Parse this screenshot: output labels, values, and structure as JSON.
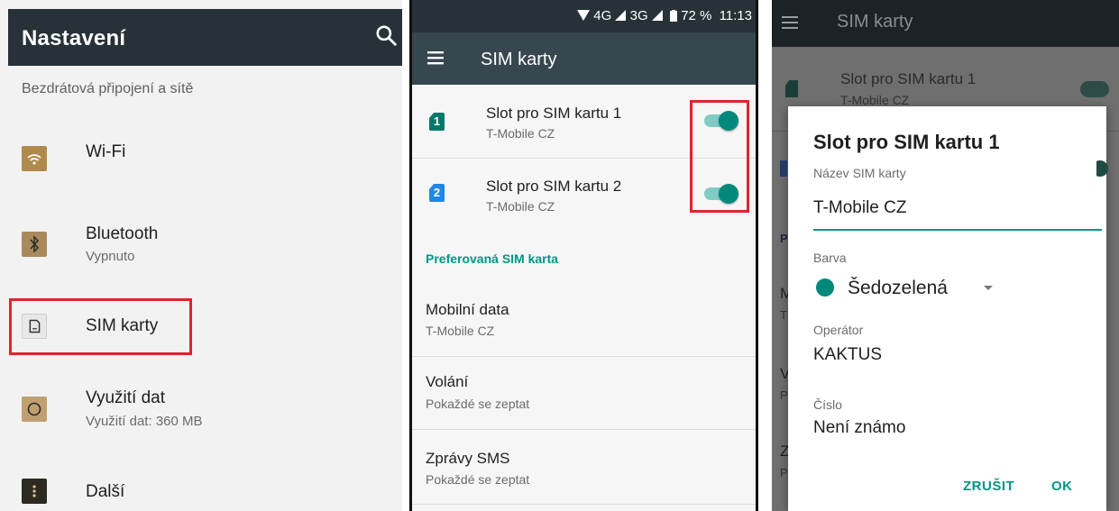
{
  "panel1": {
    "title": "Nastavení",
    "icons": {
      "search": "search-icon"
    },
    "section_header": "Bezdrátová připojení a sítě",
    "items": [
      {
        "label": "Wi-Fi",
        "sub": "",
        "icon": "wifi-icon",
        "color": "#b08a4a"
      },
      {
        "label": "Bluetooth",
        "sub": "Vypnuto",
        "icon": "bluetooth-icon",
        "color": "#a88a5c"
      },
      {
        "label": "SIM karty",
        "sub": "",
        "icon": "sim-card-icon",
        "color": "#e8e8e8"
      },
      {
        "label": "Využití dat",
        "sub": "Využití dat: 360 MB",
        "icon": "data-usage-icon",
        "color": "#c0a070"
      },
      {
        "label": "Další",
        "sub": "",
        "icon": "more-icon",
        "color": "#2d2a22"
      }
    ]
  },
  "panel2": {
    "status": {
      "network": "4G",
      "network2": "3G",
      "battery": "72 %",
      "time": "11:13"
    },
    "title": "SIM karty",
    "slots": [
      {
        "badge": "1",
        "title": "Slot pro SIM kartu 1",
        "sub": "T-Mobile CZ",
        "enabled": true,
        "badge_color": "#00796b"
      },
      {
        "badge": "2",
        "title": "Slot pro SIM kartu 2",
        "sub": "T-Mobile CZ",
        "enabled": true,
        "badge_color": "#1e88e5"
      }
    ],
    "pref_header": "Preferovaná SIM karta",
    "prefs": [
      {
        "title": "Mobilní data",
        "sub": "T-Mobile CZ"
      },
      {
        "title": "Volání",
        "sub": "Pokaždé se zeptat"
      },
      {
        "title": "Zprávy SMS",
        "sub": "Pokaždé se zeptat"
      }
    ]
  },
  "panel3": {
    "bg_title": "SIM karty",
    "bg_row_title": "Slot pro SIM kartu 1",
    "bg_row_sub": "T-Mobile CZ",
    "bg_letters": [
      "P",
      "M",
      "T",
      "V",
      "P",
      "Z",
      "P"
    ],
    "dialog": {
      "title": "Slot pro SIM kartu 1",
      "name_label": "Název SIM karty",
      "name_value": "T-Mobile CZ",
      "color_label": "Barva",
      "color_value": "Šedozelená",
      "operator_label": "Operátor",
      "operator_value": "KAKTUS",
      "number_label": "Číslo",
      "number_value": "Není známo",
      "cancel": "ZRUŠIT",
      "ok": "OK"
    }
  },
  "colors": {
    "accent": "#009688",
    "highlight": "#e0242b"
  }
}
